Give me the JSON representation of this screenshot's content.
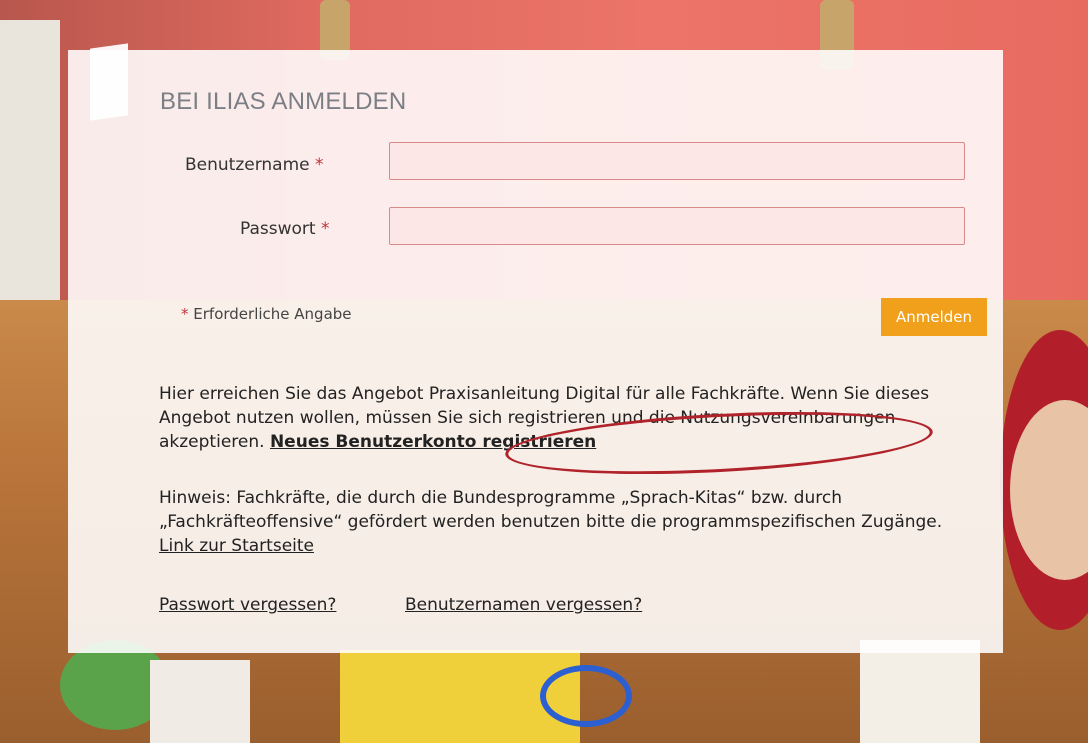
{
  "login": {
    "title": "BEI ILIAS ANMELDEN",
    "username_label": "Benutzername",
    "password_label": "Passwort",
    "required_marker": "*",
    "required_note": "Erforderliche Angabe",
    "submit_label": "Anmelden"
  },
  "info": {
    "text_1": "Hier erreichen Sie das Angebot Praxisanleitung Digital für alle Fachkräfte. Wenn Sie dieses Angebot nutzen wollen, müssen Sie sich registrieren und die Nutzungsvereinbarungen akzeptieren.",
    "register_link": "Neues Benutzerkonto registrieren",
    "text_2": "Hinweis: Fachkräfte, die durch die Bundesprogramme „Sprach-Kitas“ bzw. durch „Fachkräfteoffensive“ gefördert werden benutzen bitte die programmspezifischen Zugänge.",
    "startpage_link": "Link zur Startseite"
  },
  "links": {
    "forgot_password": "Passwort vergessen?",
    "forgot_username": "Benutzernamen vergessen?"
  },
  "colors": {
    "accent_button": "#f1a01b",
    "required": "#c0343a",
    "annotation_oval": "#b0232b",
    "input_bg": "#fde6e6"
  }
}
